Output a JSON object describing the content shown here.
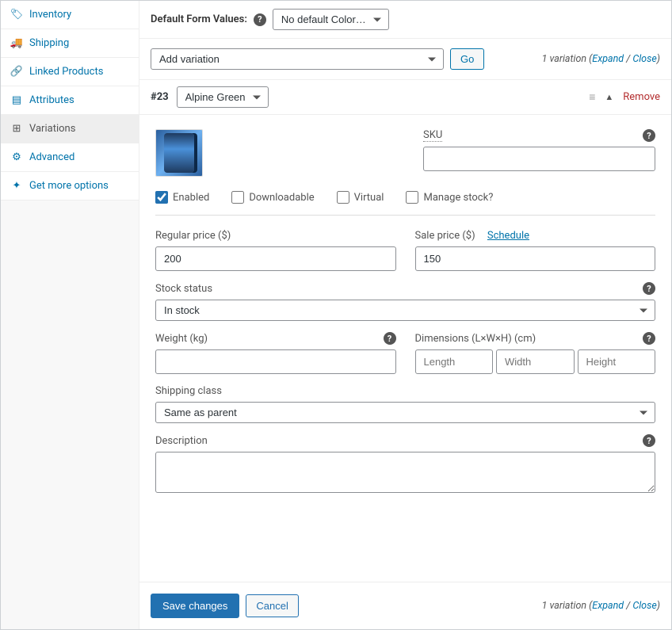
{
  "sidebar": {
    "items": [
      {
        "icon": "📦",
        "label": "Inventory",
        "name": "inventory"
      },
      {
        "icon": "🚚",
        "label": "Shipping",
        "name": "shipping"
      },
      {
        "icon": "🔗",
        "label": "Linked Products",
        "name": "linked-products"
      },
      {
        "icon": "▦",
        "label": "Attributes",
        "name": "attributes"
      },
      {
        "icon": "⊞",
        "label": "Variations",
        "name": "variations"
      },
      {
        "icon": "⚙",
        "label": "Advanced",
        "name": "advanced"
      },
      {
        "icon": "✦",
        "label": "Get more options",
        "name": "get-more-options"
      }
    ],
    "active_index": 4
  },
  "default_form": {
    "label": "Default Form Values:",
    "selected": "No default Color…"
  },
  "toolbar": {
    "add_variation": "Add variation",
    "go": "Go",
    "summary_count": "1 variation",
    "expand": "Expand",
    "close": "Close"
  },
  "variation": {
    "id": "#23",
    "color_selected": "Alpine Green",
    "remove": "Remove",
    "sku_label": "SKU",
    "sku_value": "",
    "checks": {
      "enabled": {
        "label": "Enabled",
        "checked": true
      },
      "downloadable": {
        "label": "Downloadable",
        "checked": false
      },
      "virtual": {
        "label": "Virtual",
        "checked": false
      },
      "manage_stock": {
        "label": "Manage stock?",
        "checked": false
      }
    },
    "regular_price_label": "Regular price ($)",
    "regular_price": "200",
    "sale_price_label": "Sale price ($)",
    "schedule": "Schedule",
    "sale_price": "150",
    "stock_status_label": "Stock status",
    "stock_status": "In stock",
    "weight_label": "Weight (kg)",
    "weight": "",
    "dimensions_label": "Dimensions (L×W×H) (cm)",
    "dim_placeholders": {
      "l": "Length",
      "w": "Width",
      "h": "Height"
    },
    "shipping_class_label": "Shipping class",
    "shipping_class": "Same as parent",
    "description_label": "Description",
    "description": ""
  },
  "footer": {
    "save": "Save changes",
    "cancel": "Cancel",
    "summary_count": "1 variation",
    "expand": "Expand",
    "close": "Close"
  }
}
